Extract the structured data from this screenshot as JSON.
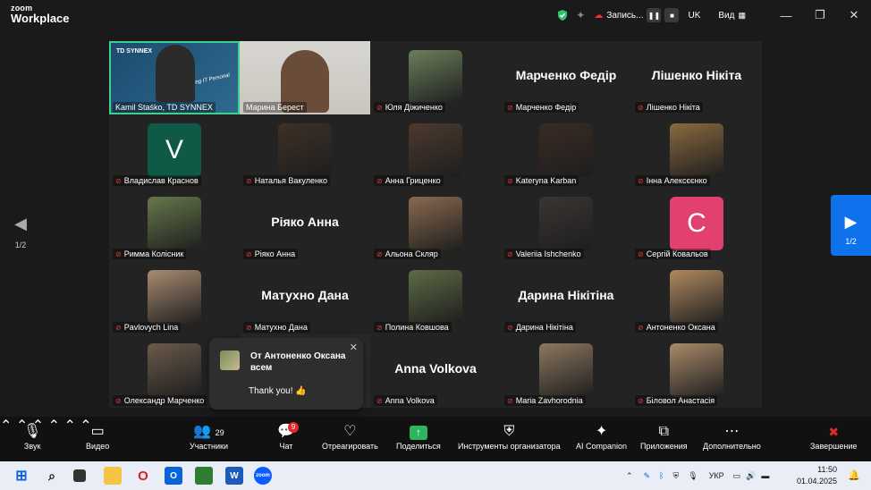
{
  "app": {
    "logo_top": "zoom",
    "logo_bottom": "Workplace",
    "recording_label": "Запись...",
    "language": "UK",
    "view_label": "Вид"
  },
  "navigation": {
    "left_page": "1/2",
    "right_page": "1/2"
  },
  "participants": [
    {
      "name": "Kamil Staśko, TD SYNNEX",
      "type": "video",
      "active": true
    },
    {
      "name": "Марина Берест",
      "type": "video"
    },
    {
      "name": "Юля Діжиченко",
      "type": "photo"
    },
    {
      "name": "Марченко Федір",
      "type": "name"
    },
    {
      "name": "Лішенко Нікіта",
      "type": "name"
    },
    {
      "name": "Владислав Краснов",
      "type": "letter",
      "letter": "V",
      "color": "#0f5a47"
    },
    {
      "name": "Наталья Вакуленко",
      "type": "photo"
    },
    {
      "name": "Анна Гриценко",
      "type": "photo"
    },
    {
      "name": "Kateryna Karban",
      "type": "photo"
    },
    {
      "name": "Інна Алексєєнко",
      "type": "photo"
    },
    {
      "name": "Римма Колісник",
      "type": "photo"
    },
    {
      "name": "Ріяко Анна",
      "type": "name"
    },
    {
      "name": "Альона Скляр",
      "type": "photo"
    },
    {
      "name": "Valeriia Ishchenko",
      "type": "photo"
    },
    {
      "name": "Сергій Ковальов",
      "type": "letter",
      "letter": "C",
      "color": "#e2416f"
    },
    {
      "name": "Pavlovych Lina",
      "type": "photo"
    },
    {
      "name": "Матухно Дана",
      "type": "name"
    },
    {
      "name": "Полина Ковшова",
      "type": "photo"
    },
    {
      "name": "Дарина Нікітіна",
      "type": "name"
    },
    {
      "name": "Антоненко Оксана",
      "type": "photo"
    },
    {
      "name": "Олександр Марченко",
      "type": "photo"
    },
    {
      "name": "",
      "type": "empty"
    },
    {
      "name": "Anna Volkova",
      "type": "name"
    },
    {
      "name": "Maria Zavhorodnia",
      "type": "photo"
    },
    {
      "name": "Біловол Анастасія",
      "type": "photo"
    }
  ],
  "slide_overlay": {
    "brand": "TD SYNNEX",
    "tag": "ying IT Personal"
  },
  "chat_toast": {
    "from": "От Антоненко Оксана всем",
    "message": "Thank you! 👍"
  },
  "toolbar": {
    "audio": "Звук",
    "video": "Видео",
    "participants": "Участники",
    "participants_count": "29",
    "chat": "Чат",
    "chat_badge": "9",
    "react": "Отреагировать",
    "share": "Поделиться",
    "host_tools": "Инструменты организатора",
    "ai": "AI Companion",
    "apps": "Приложения",
    "more": "Дополнительно",
    "end": "Завершение"
  },
  "taskbar": {
    "lang": "УКР",
    "time": "11:50",
    "date": "01.04.2025"
  }
}
